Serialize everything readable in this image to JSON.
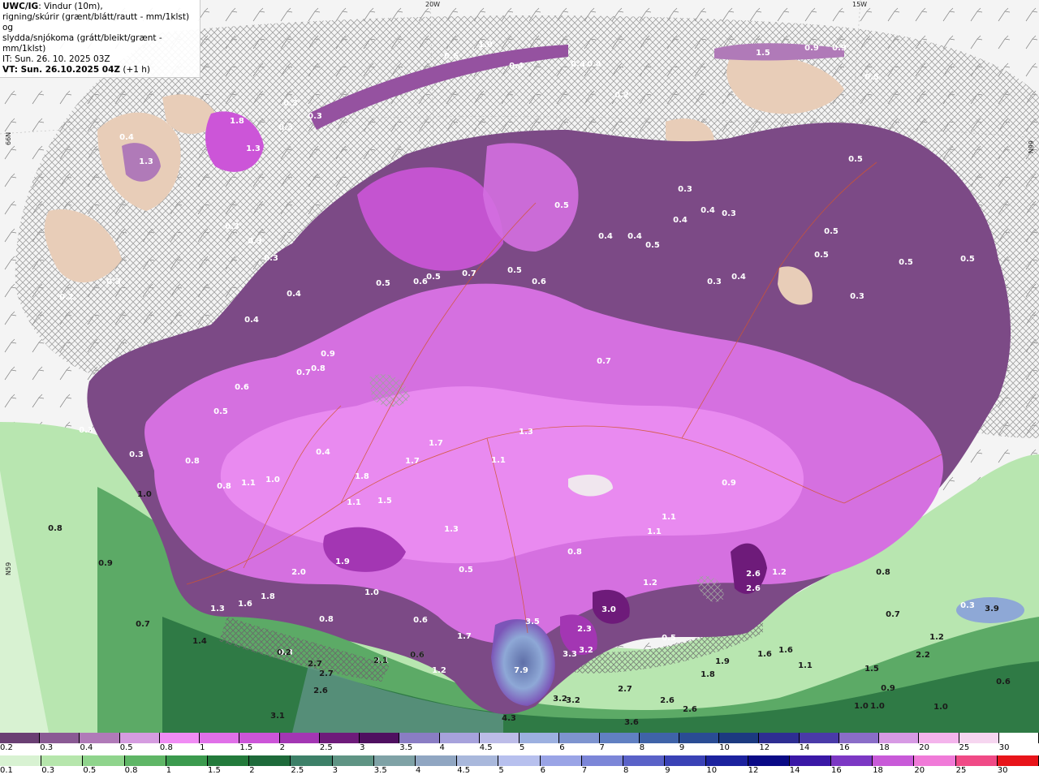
{
  "info": {
    "line1_bold": "UWC/IG",
    "line1_rest": ": Vindur (10m),",
    "line2": "rigning/skúrir (grænt/blátt/rautt - mm/1klst) og",
    "line3": "slydda/snjókoma (grátt/bleikt/grænt - mm/1klst)",
    "line4": "IT: Sun. 26. 10. 2025 03Z",
    "line5": "VT: Sun. 26.10.2025 04Z",
    "line5_suffix": " (+1 h)"
  },
  "grid_labels": {
    "lon_20w": "20W",
    "lon_15w": "15W",
    "lat_66n_left": "66N",
    "lat_66n_right": "66N",
    "lat_65n_left": "N59"
  },
  "colors": {
    "ocean": "#f4f4f4",
    "hatch": "#9a9a9a",
    "land_tan": "#e8cdb8",
    "snow_light": "#b07ab8",
    "snow_mid": "#9552a0",
    "snow_dark": "#6e3576",
    "snow_pink": "#e070e8",
    "snow_magenta": "#cc55d8",
    "rain_light": "#b8e6b0",
    "rain_mid": "#5caa66",
    "rain_dark": "#2f7a45",
    "rain_blue": "#8ea8d6",
    "roads": "#d2552e"
  },
  "precip_values": [
    {
      "t": "1.0",
      "d": 0
    },
    {
      "t": "0.6",
      "d": 0
    },
    {
      "t": "0.4",
      "d": 0
    },
    {
      "t": "0.4",
      "d": 0
    },
    {
      "t": "0.4",
      "d": 0
    },
    {
      "t": "0.2",
      "d": 0
    },
    {
      "t": "1.5",
      "d": 0
    },
    {
      "t": "0.9",
      "d": 0
    },
    {
      "t": "0.9",
      "d": 0
    },
    {
      "t": "0.5",
      "d": 0
    },
    {
      "t": "1.8",
      "d": 0
    },
    {
      "t": "1.3",
      "d": 0
    },
    {
      "t": "1.3",
      "d": 0
    },
    {
      "t": "0.4",
      "d": 0
    },
    {
      "t": "0.3",
      "d": 0
    },
    {
      "t": "0.3",
      "d": 0
    },
    {
      "t": "0.3",
      "d": 0
    },
    {
      "t": "0.3",
      "d": 0
    },
    {
      "t": "0.3",
      "d": 0
    },
    {
      "t": "0.3",
      "d": 0
    },
    {
      "t": "0.2",
      "d": 0
    },
    {
      "t": "0.4",
      "d": 0
    },
    {
      "t": "0.3",
      "d": 0
    },
    {
      "t": "0.4",
      "d": 0
    },
    {
      "t": "0.9",
      "d": 0
    },
    {
      "t": "0.8",
      "d": 0
    },
    {
      "t": "0.7",
      "d": 0
    },
    {
      "t": "0.6",
      "d": 0
    },
    {
      "t": "0.5",
      "d": 0
    },
    {
      "t": "0.8",
      "d": 0
    },
    {
      "t": "0.3",
      "d": 0
    },
    {
      "t": "0.3",
      "d": 0
    },
    {
      "t": "0.8",
      "d": 0
    },
    {
      "t": "1.1",
      "d": 0
    },
    {
      "t": "1.0",
      "d": 0
    },
    {
      "t": "0.4",
      "d": 0
    },
    {
      "t": "0.5",
      "d": 0
    },
    {
      "t": "0.6",
      "d": 0
    },
    {
      "t": "0.5",
      "d": 0
    },
    {
      "t": "0.7",
      "d": 0
    },
    {
      "t": "0.5",
      "d": 0
    },
    {
      "t": "0.6",
      "d": 0
    },
    {
      "t": "0.5",
      "d": 0
    },
    {
      "t": "0.4",
      "d": 0
    },
    {
      "t": "0.4",
      "d": 0
    },
    {
      "t": "0.5",
      "d": 0
    },
    {
      "t": "0.4",
      "d": 0
    },
    {
      "t": "0.3",
      "d": 0
    },
    {
      "t": "0.4",
      "d": 0
    },
    {
      "t": "0.3",
      "d": 0
    },
    {
      "t": "0.3",
      "d": 0
    },
    {
      "t": "0.4",
      "d": 0
    },
    {
      "t": "0.5",
      "d": 0
    },
    {
      "t": "0.5",
      "d": 0
    },
    {
      "t": "0.5",
      "d": 0
    },
    {
      "t": "0.3",
      "d": 0
    },
    {
      "t": "0.5",
      "d": 0
    },
    {
      "t": "0.5",
      "d": 0
    },
    {
      "t": "1.7",
      "d": 0
    },
    {
      "t": "1.7",
      "d": 0
    },
    {
      "t": "1.8",
      "d": 0
    },
    {
      "t": "1.1",
      "d": 0
    },
    {
      "t": "1.3",
      "d": 0
    },
    {
      "t": "1.5",
      "d": 0
    },
    {
      "t": "1.3",
      "d": 0
    },
    {
      "t": "1.1",
      "d": 0
    },
    {
      "t": "0.7",
      "d": 0
    },
    {
      "t": "0.9",
      "d": 0
    },
    {
      "t": "1.1",
      "d": 0
    },
    {
      "t": "1.1",
      "d": 0
    },
    {
      "t": "0.8",
      "d": 0
    },
    {
      "t": "1.2",
      "d": 0
    },
    {
      "t": "1.9",
      "d": 0
    },
    {
      "t": "2.0",
      "d": 0
    },
    {
      "t": "1.6",
      "d": 0
    },
    {
      "t": "1.8",
      "d": 0
    },
    {
      "t": "1.3",
      "d": 0
    },
    {
      "t": "0.8",
      "d": 0
    },
    {
      "t": "1.0",
      "d": 0
    },
    {
      "t": "0.6",
      "d": 0
    },
    {
      "t": "0.5",
      "d": 0
    },
    {
      "t": "3.0",
      "d": 0
    },
    {
      "t": "2.6",
      "d": 0
    },
    {
      "t": "2.6",
      "d": 0
    },
    {
      "t": "3.5",
      "d": 0
    },
    {
      "t": "2.3",
      "d": 0
    },
    {
      "t": "3.3",
      "d": 0
    },
    {
      "t": "3.2",
      "d": 0
    },
    {
      "t": "7.9",
      "d": 0
    },
    {
      "t": "1.7",
      "d": 0
    },
    {
      "t": "1.2",
      "d": 0
    },
    {
      "t": "1.2",
      "d": 0
    },
    {
      "t": "0.5",
      "d": 0
    },
    {
      "t": "2.1",
      "d": 0
    },
    {
      "t": "0.6",
      "d": 0
    },
    {
      "t": "0.3",
      "d": 0
    },
    {
      "t": "1.0",
      "d": 1
    },
    {
      "t": "0.8",
      "d": 1
    },
    {
      "t": "0.9",
      "d": 1
    },
    {
      "t": "0.7",
      "d": 1
    },
    {
      "t": "1.4",
      "d": 1
    },
    {
      "t": "0.2",
      "d": 1
    },
    {
      "t": "2.7",
      "d": 1
    },
    {
      "t": "2.7",
      "d": 1
    },
    {
      "t": "2.6",
      "d": 1
    },
    {
      "t": "3.1",
      "d": 1
    },
    {
      "t": "2.1",
      "d": 1
    },
    {
      "t": "0.6",
      "d": 1
    },
    {
      "t": "3.2",
      "d": 1
    },
    {
      "t": "3.2",
      "d": 1
    },
    {
      "t": "2.7",
      "d": 1
    },
    {
      "t": "2.6",
      "d": 1
    },
    {
      "t": "2.6",
      "d": 1
    },
    {
      "t": "3.6",
      "d": 1
    },
    {
      "t": "1.8",
      "d": 1
    },
    {
      "t": "1.9",
      "d": 1
    },
    {
      "t": "1.6",
      "d": 1
    },
    {
      "t": "1.6",
      "d": 1
    },
    {
      "t": "1.1",
      "d": 1
    },
    {
      "t": "1.5",
      "d": 1
    },
    {
      "t": "0.9",
      "d": 1
    },
    {
      "t": "1.0",
      "d": 1
    },
    {
      "t": "1.0",
      "d": 1
    },
    {
      "t": "1.0",
      "d": 1
    },
    {
      "t": "2.2",
      "d": 1
    },
    {
      "t": "1.2",
      "d": 1
    },
    {
      "t": "0.6",
      "d": 1
    },
    {
      "t": "0.7",
      "d": 1
    },
    {
      "t": "0.8",
      "d": 1
    },
    {
      "t": "0.3",
      "d": 0
    },
    {
      "t": "3.9",
      "d": 1
    },
    {
      "t": "4.3",
      "d": 1
    }
  ],
  "legend_snow": {
    "labels": [
      "0.2",
      "0.3",
      "0.4",
      "0.5",
      "0.8",
      "1",
      "1.5",
      "2",
      "2.5",
      "3",
      "3.5",
      "4",
      "4.5",
      "5",
      "6",
      "7",
      "8",
      "9",
      "10",
      "12",
      "14",
      "16",
      "18",
      "20",
      "25",
      "30"
    ],
    "colors": [
      "#6a3f73",
      "#8a5a94",
      "#b07ab8",
      "#d59ce0",
      "#f08cf4",
      "#e070e8",
      "#cc55d8",
      "#a336b3",
      "#6e1b7a",
      "#4f1060",
      "#8a7dc4",
      "#a7a2dc",
      "#bcbce8",
      "#9cb0e0",
      "#7e94cf",
      "#6180c2",
      "#3f63a8",
      "#2a4c94",
      "#1c3a80",
      "#2e2e92",
      "#4a3aa8",
      "#8a6dc8",
      "#d79ae4",
      "#f4b4ec",
      "#f6d6f0",
      "#ffffff"
    ]
  },
  "legend_rain": {
    "labels": [
      "0.1",
      "0.3",
      "0.5",
      "0.8",
      "1",
      "1.5",
      "2",
      "2.5",
      "3",
      "3.5",
      "4",
      "4.5",
      "5",
      "6",
      "7",
      "8",
      "9",
      "10",
      "12",
      "14",
      "16",
      "18",
      "20",
      "25",
      "30"
    ],
    "colors": [
      "#d8f2d2",
      "#b6e6ac",
      "#8fd48c",
      "#5fb666",
      "#3b9a4e",
      "#237a3b",
      "#1e6a3a",
      "#3d8068",
      "#5f9484",
      "#7fa2a6",
      "#90a6c2",
      "#a9b8dc",
      "#b7c0ee",
      "#9aa4e6",
      "#7c86d8",
      "#5a62c8",
      "#3a42b6",
      "#1c229e",
      "#0a0a86",
      "#3a18a6",
      "#7c38c4",
      "#c85ad8",
      "#f07ad8",
      "#f04a86",
      "#e8141a"
    ]
  }
}
